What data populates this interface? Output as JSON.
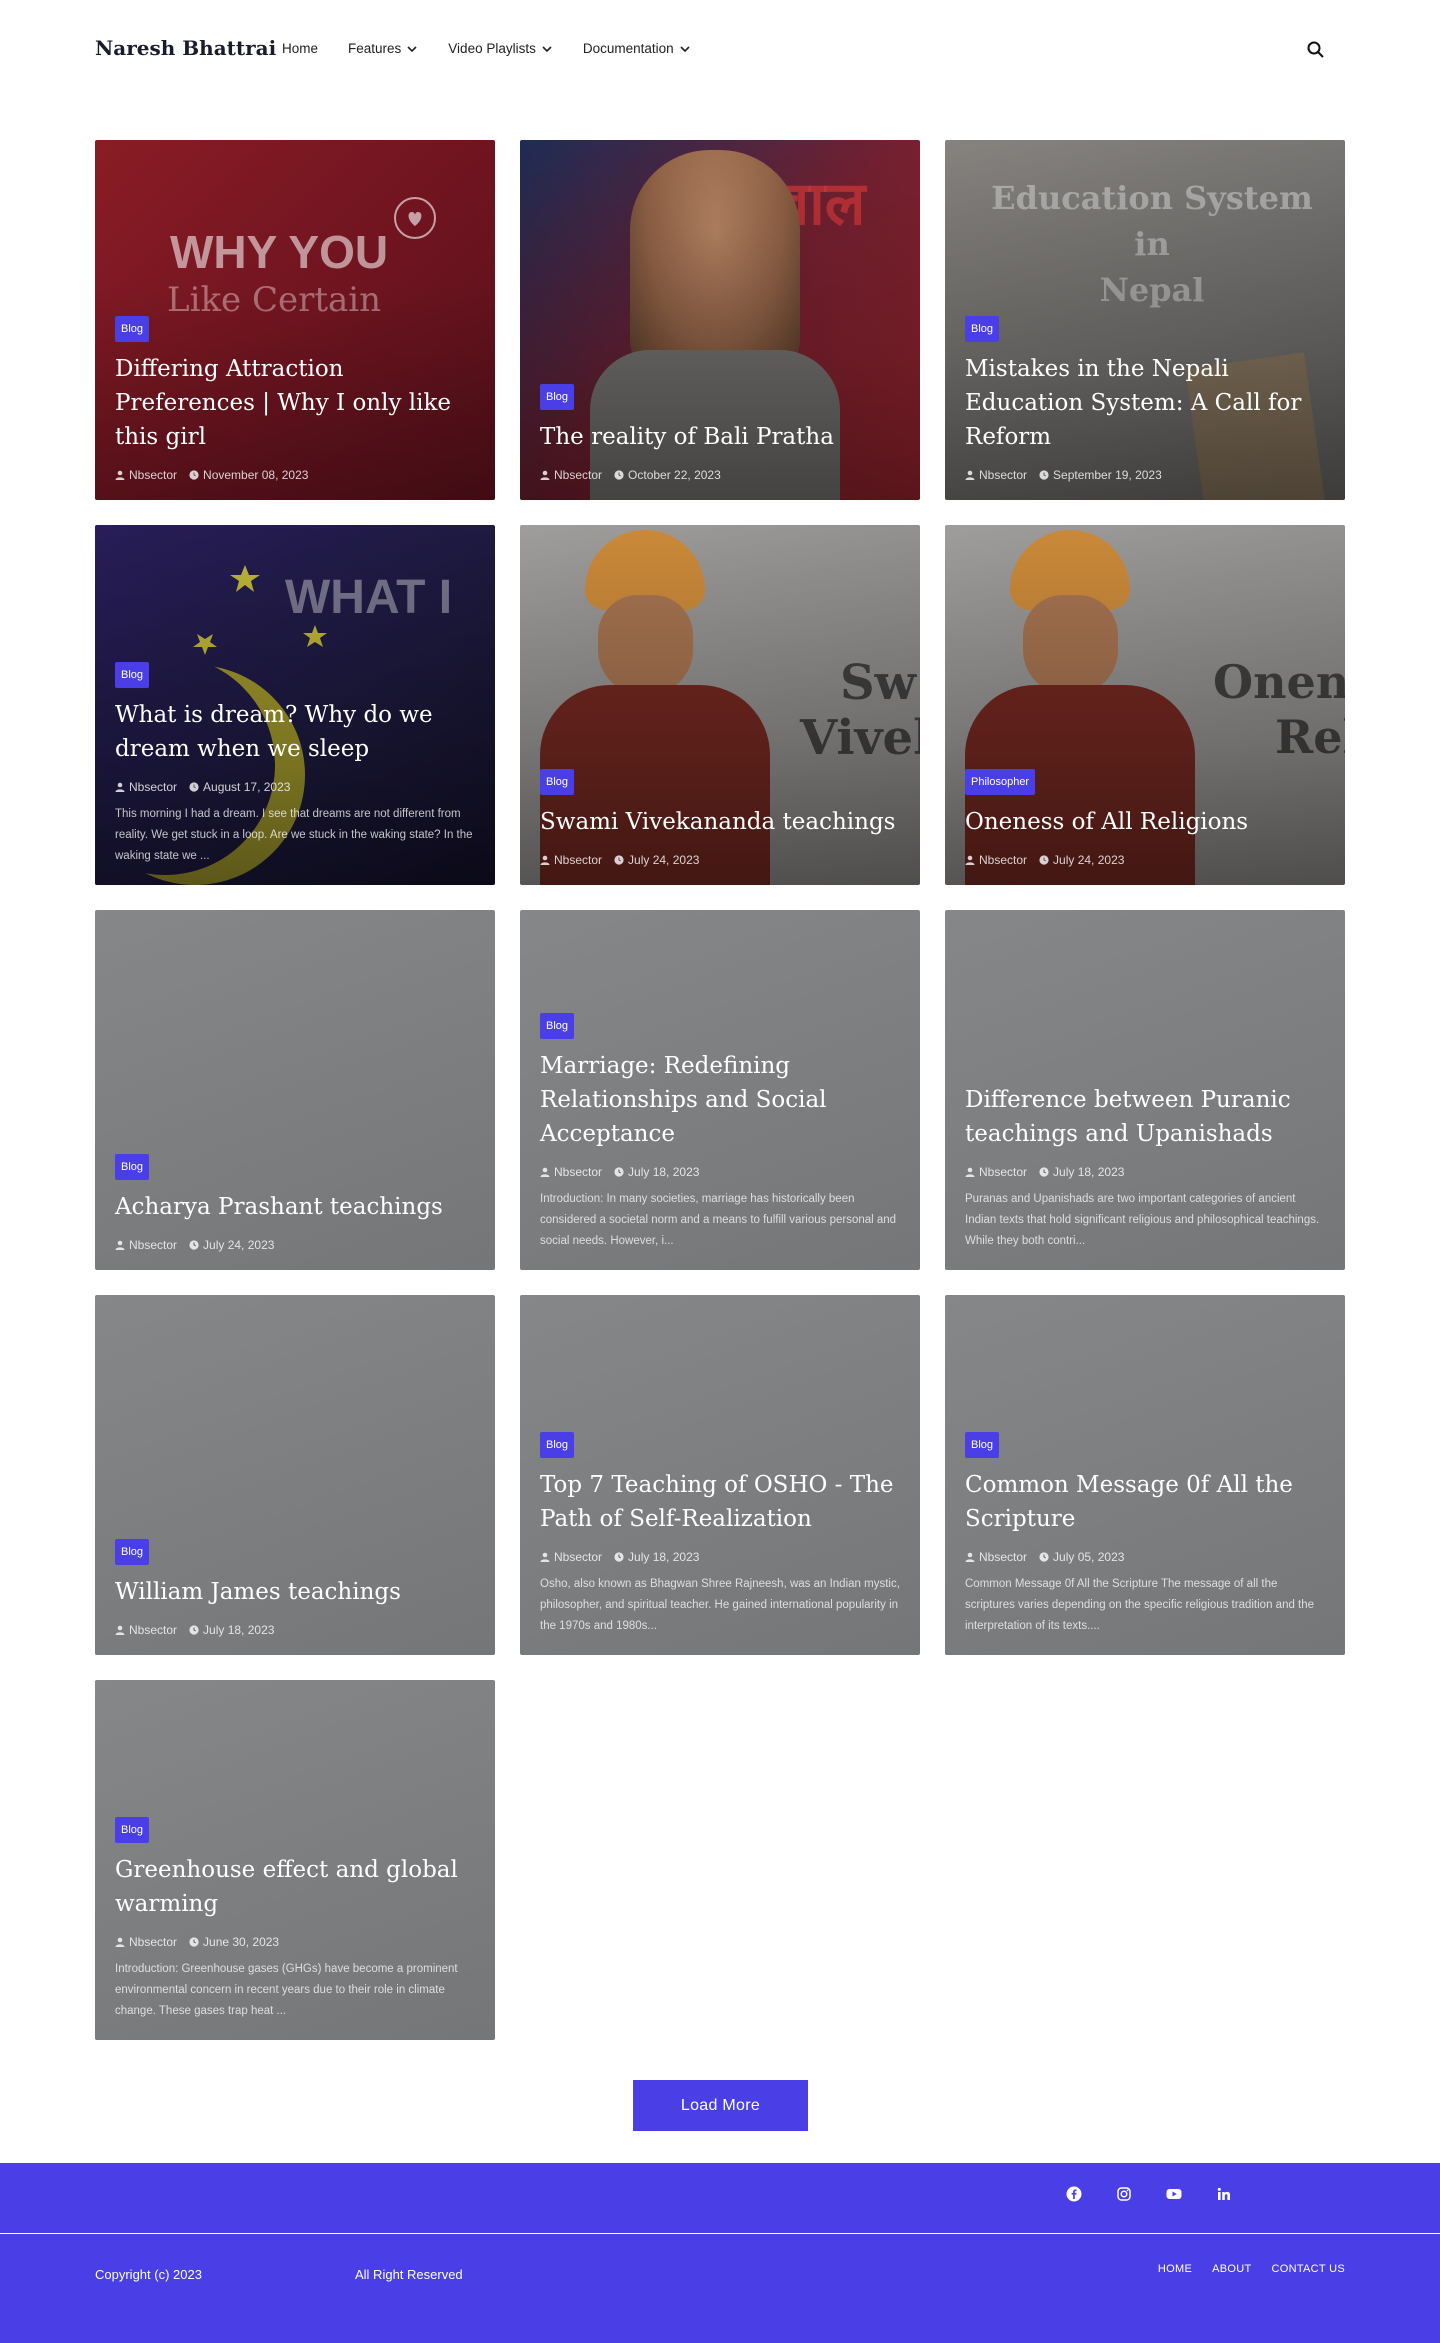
{
  "brand": "Naresh Bhattrai",
  "nav": {
    "home": "Home",
    "features": "Features",
    "video_playlists": "Video Playlists",
    "documentation": "Documentation"
  },
  "cards": [
    {
      "category": "Blog",
      "title": "Differing Attraction Preferences | Why I only like this girl",
      "author": "Nbsector",
      "date": "November 08, 2023",
      "excerpt": "",
      "art": "WHY YOU Like Certain Types of GIRL"
    },
    {
      "category": "Blog",
      "title": "The reality of Bali Pratha",
      "author": "Nbsector",
      "date": "October 22, 2023",
      "excerpt": "",
      "art": "बाल"
    },
    {
      "category": "Blog",
      "title": "Mistakes in the Nepali Education System: A Call for Reform",
      "author": "Nbsector",
      "date": "September 19, 2023",
      "excerpt": "",
      "art": "Education System in Nepal"
    },
    {
      "category": "Blog",
      "title": "What is dream? Why do we dream when we sleep",
      "author": "Nbsector",
      "date": "August 17, 2023",
      "excerpt": "This morning I had a dream. I see that dreams are not different from reality. We get stuck in a loop. Are we stuck in the waking state? In the waking state we ...",
      "art": "WHAT I"
    },
    {
      "category": "Blog",
      "title": "Swami Vivekananda teachings",
      "author": "Nbsector",
      "date": "July 24, 2023",
      "excerpt": "",
      "art": "Sw Vivek"
    },
    {
      "category": "Philosopher",
      "title": "Oneness of All Religions",
      "author": "Nbsector",
      "date": "July 24, 2023",
      "excerpt": "",
      "art": "Onen Rel"
    },
    {
      "category": "Blog",
      "title": "Acharya Prashant teachings",
      "author": "Nbsector",
      "date": "July 24, 2023",
      "excerpt": ""
    },
    {
      "category": "Blog",
      "title": "Marriage: Redefining Relationships and Social Acceptance",
      "author": "Nbsector",
      "date": "July 18, 2023",
      "excerpt": "Introduction: In many societies, marriage has historically been considered a societal norm and a means to fulfill various personal and social needs. However, i..."
    },
    {
      "category": "Blog",
      "title": "Difference between Puranic teachings and Upanishads",
      "author": "Nbsector",
      "date": "July 18, 2023",
      "excerpt": "Puranas and Upanishads are two important categories of ancient Indian texts that hold significant religious and philosophical teachings. While they both contri..."
    },
    {
      "category": "Blog",
      "title": "William James teachings",
      "author": "Nbsector",
      "date": "July 18, 2023",
      "excerpt": ""
    },
    {
      "category": "Blog",
      "title": "Top 7 Teaching of OSHO - The Path of Self-Realization",
      "author": "Nbsector",
      "date": "July 18, 2023",
      "excerpt": "Osho, also known as Bhagwan Shree Rajneesh, was an Indian mystic, philosopher, and spiritual teacher. He gained international popularity in the 1970s and 1980s..."
    },
    {
      "category": "Blog",
      "title": "Common Message 0f All the Scripture",
      "author": "Nbsector",
      "date": "July 05, 2023",
      "excerpt": "Common Message 0f All the Scripture The message of all the scriptures varies depending on the specific religious tradition and the interpretation of its texts...."
    },
    {
      "category": "Blog",
      "title": "Greenhouse effect and global warming",
      "author": "Nbsector",
      "date": "June 30, 2023",
      "excerpt": "Introduction: Greenhouse gases (GHGs) have become a prominent environmental concern in recent years due to their role in climate change. These gases trap heat ..."
    }
  ],
  "load_more": "Load More",
  "footer": {
    "copyright": "Copyright (c) 2023",
    "rights": "All Right Reserved",
    "links": [
      "HOME",
      "ABOUT",
      "CONTACT US"
    ],
    "socials": [
      "facebook-icon",
      "instagram-icon",
      "youtube-icon",
      "linkedin-icon"
    ]
  },
  "colors": {
    "accent": "#4a3fe6",
    "card_grey": "#7b7d80"
  }
}
